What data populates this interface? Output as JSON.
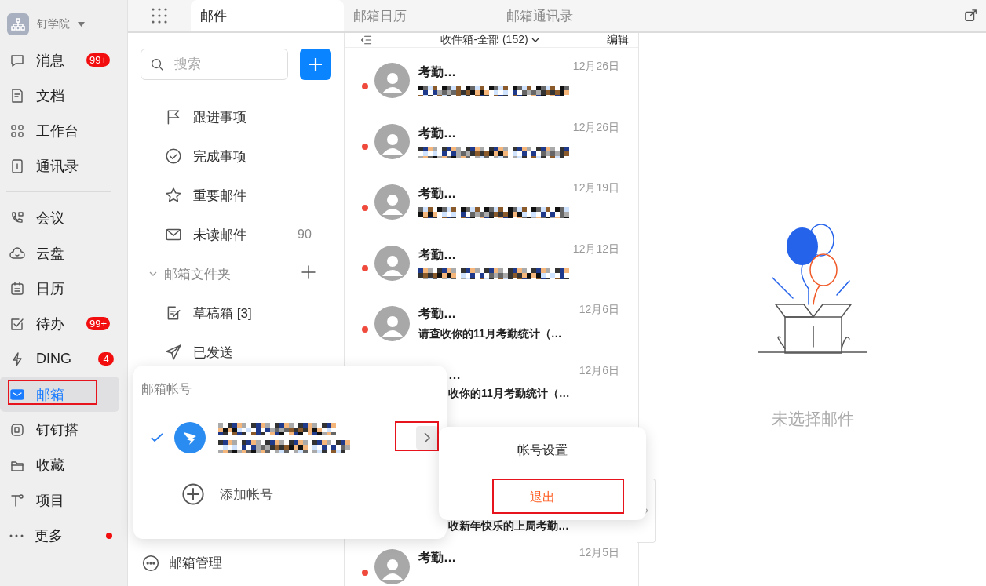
{
  "sidebar": {
    "org": {
      "name": "钉学院"
    },
    "groups": [
      [
        {
          "label": "消息",
          "badge": "99+",
          "dot": false,
          "selected": false,
          "highlighted": false
        },
        {
          "label": "文档",
          "dot": false,
          "selected": false,
          "highlighted": false
        },
        {
          "label": "工作台",
          "dot": false,
          "selected": false,
          "highlighted": false
        },
        {
          "label": "通讯录",
          "dot": false,
          "selected": false,
          "highlighted": false
        }
      ],
      [
        {
          "label": "会议",
          "dot": false,
          "selected": false,
          "highlighted": false
        },
        {
          "label": "云盘",
          "dot": false,
          "selected": false,
          "highlighted": false
        },
        {
          "label": "日历",
          "dot": false,
          "selected": false,
          "highlighted": false
        },
        {
          "label": "待办",
          "badge": "99+",
          "dot": false,
          "selected": false,
          "highlighted": false
        },
        {
          "label": "DING",
          "badge": "4",
          "dot": false,
          "selected": false,
          "highlighted": false
        },
        {
          "label": "邮箱",
          "dot": false,
          "selected": true,
          "highlighted": true
        },
        {
          "label": "钉钉搭",
          "dot": false,
          "selected": false,
          "highlighted": false
        },
        {
          "label": "收藏",
          "dot": false,
          "selected": false,
          "highlighted": false
        },
        {
          "label": "项目",
          "dot": false,
          "selected": false,
          "highlighted": false
        },
        {
          "label": "更多",
          "dot": true,
          "selected": false,
          "highlighted": false
        }
      ]
    ]
  },
  "tabs": [
    {
      "label": "邮件",
      "selected": true
    },
    {
      "label": "邮箱日历",
      "selected": false
    },
    {
      "label": "邮箱通讯录",
      "selected": false
    }
  ],
  "folders": {
    "search": {
      "placeholder": "搜索"
    },
    "quick": [
      {
        "label": "跟进事项"
      },
      {
        "label": "完成事项"
      },
      {
        "label": "重要邮件"
      },
      {
        "label": "未读邮件",
        "count": "90"
      }
    ],
    "section": {
      "label": "邮箱文件夹",
      "expanded": true
    },
    "items": [
      {
        "label": "草稿箱 [3]"
      },
      {
        "label": "已发送"
      }
    ],
    "manage": {
      "label": "邮箱管理"
    }
  },
  "mail_list": {
    "title": "收件箱-全部 (152)",
    "edit": "编辑",
    "rows": [
      {
        "kind": "redacted",
        "sender": "考勤…",
        "date": "12月26日",
        "unread": true
      },
      {
        "kind": "redacted",
        "sender": "考勤…",
        "date": "12月26日",
        "unread": true
      },
      {
        "kind": "redacted",
        "sender": "考勤…",
        "date": "12月19日",
        "unread": true
      },
      {
        "kind": "redacted",
        "sender": "考勤…",
        "date": "12月12日",
        "unread": true
      },
      {
        "kind": "full",
        "sender": "考勤…",
        "date": "12月6日",
        "subject": "请查收你的11月考勤统计（…",
        "unread": true
      },
      {
        "kind": "partial",
        "sender": "…",
        "date": "12月6日",
        "subject": "收你的11月考勤统计（…"
      },
      {
        "kind": "covered"
      },
      {
        "kind": "partial",
        "subject": "收新年快乐的上周考勤…"
      },
      {
        "kind": "head",
        "sender": "考勤…",
        "date": "12月5日",
        "unread": true
      }
    ]
  },
  "preview": {
    "empty_text": "未选择邮件"
  },
  "account_popup": {
    "title": "邮箱帐号",
    "accounts": [
      {
        "selected": true,
        "highlighted": true
      }
    ],
    "add_label": "添加帐号"
  },
  "account_menu": {
    "items": [
      {
        "label": "帐号设置",
        "kind": "normal",
        "highlighted": false
      },
      {
        "label": "退出",
        "kind": "danger",
        "highlighted": true
      }
    ]
  }
}
